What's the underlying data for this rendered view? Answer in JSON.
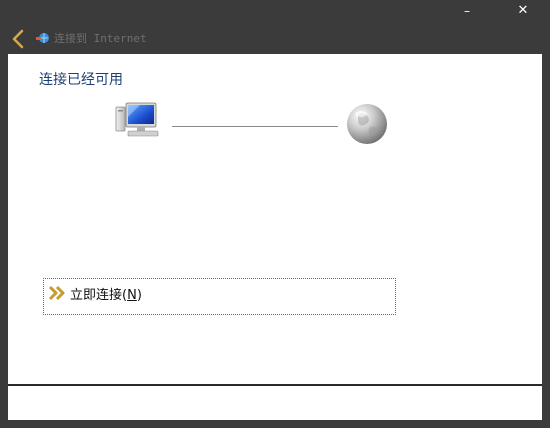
{
  "window": {
    "minimize_glyph": "–",
    "close_glyph": "✕"
  },
  "nav": {
    "back_icon": "chevron-left-icon",
    "title_icon": "network-globe-icon",
    "title_label": "连接到 Internet"
  },
  "main": {
    "heading": "连接已经可用",
    "left_device_icon": "computer-icon",
    "right_device_icon": "internet-globe-icon",
    "connect_action": {
      "icon": "double-chevron-right-icon",
      "label": "立即连接",
      "accelerator_open": "(",
      "accelerator_key": "N",
      "accelerator_close": ")"
    }
  },
  "colors": {
    "heading": "#1e3f73",
    "back_arrow": "#d4a84a",
    "arrow_icon": "#c89b2c",
    "chrome": "#3b3b3b"
  }
}
